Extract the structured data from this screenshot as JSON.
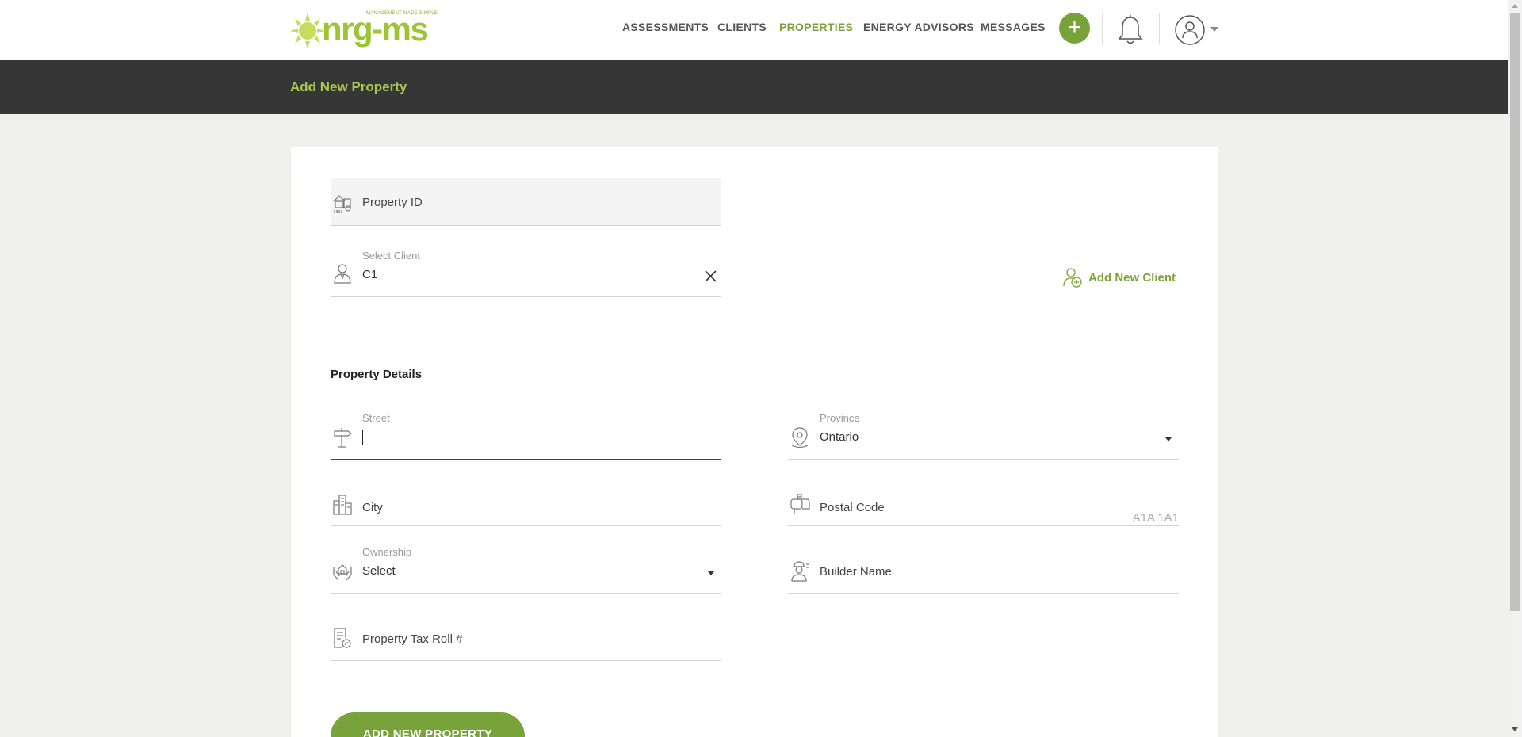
{
  "brand": {
    "name": "nrg-ms",
    "tagline": "MANAGEMENT MADE SIMPLE"
  },
  "nav": {
    "items": [
      {
        "label": "ASSESSMENTS",
        "active": false
      },
      {
        "label": "CLIENTS",
        "active": false
      },
      {
        "label": "PROPERTIES",
        "active": true
      },
      {
        "label": "ENERGY ADVISORS",
        "active": false
      },
      {
        "label": "MESSAGES",
        "active": false
      }
    ],
    "add_symbol": "+"
  },
  "page": {
    "title": "Add New Property"
  },
  "form": {
    "property_id": {
      "placeholder": "Property ID"
    },
    "client": {
      "label": "Select Client",
      "value": "C1"
    },
    "add_client_label": "Add New Client",
    "section_title": "Property Details",
    "street": {
      "label": "Street",
      "value": ""
    },
    "province": {
      "label": "Province",
      "value": "Ontario"
    },
    "city": {
      "placeholder": "City"
    },
    "postal_code": {
      "placeholder": "Postal Code",
      "hint": "A1A 1A1"
    },
    "ownership": {
      "label": "Ownership",
      "value": "Select"
    },
    "builder_name": {
      "placeholder": "Builder Name"
    },
    "tax_roll": {
      "placeholder": "Property Tax Roll #"
    },
    "submit_label": "ADD NEW PROPERTY"
  },
  "colors": {
    "accent": "#77a33a",
    "accent_light": "#a8c84a",
    "header_dark": "#363636",
    "page_bg": "#f0f0ec"
  }
}
